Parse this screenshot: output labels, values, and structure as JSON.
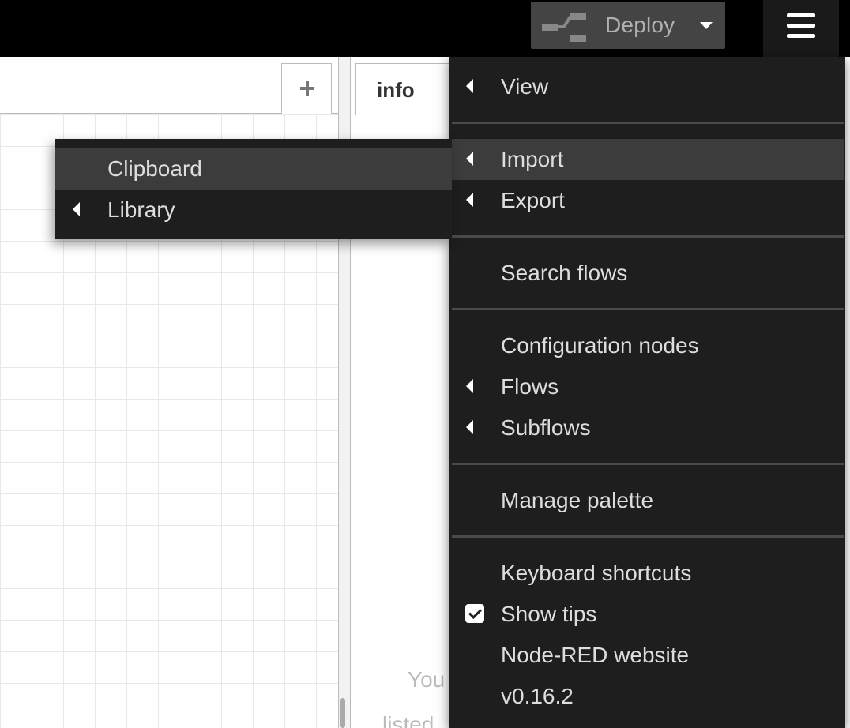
{
  "header": {
    "deploy_label": "Deploy",
    "deploy_icon": "deploy-flow-icon",
    "deploy_caret_icon": "caret-down-icon",
    "menu_icon": "hamburger-icon"
  },
  "workspace": {
    "add_tab_label": "+"
  },
  "sidebar": {
    "tab_label": "info",
    "text_line_1": "You",
    "text_line_2": "listed"
  },
  "menu": {
    "items": [
      {
        "label": "View",
        "submenu": true
      },
      {
        "label": "Import",
        "submenu": true,
        "highlighted": true
      },
      {
        "label": "Export",
        "submenu": true
      },
      {
        "label": "Search flows"
      },
      {
        "label": "Configuration nodes"
      },
      {
        "label": "Flows",
        "submenu": true
      },
      {
        "label": "Subflows",
        "submenu": true
      },
      {
        "label": "Manage palette"
      },
      {
        "label": "Keyboard shortcuts"
      },
      {
        "label": "Show tips",
        "checked": true
      },
      {
        "label": "Node-RED website"
      },
      {
        "label": "v0.16.2"
      }
    ]
  },
  "import_submenu": {
    "items": [
      {
        "label": "Clipboard",
        "highlighted": true
      },
      {
        "label": "Library",
        "submenu": true
      }
    ]
  }
}
